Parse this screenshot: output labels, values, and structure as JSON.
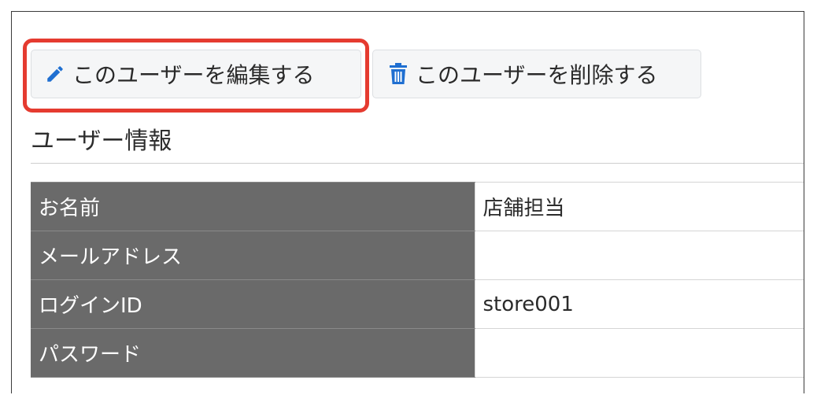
{
  "toolbar": {
    "edit_label": "このユーザーを編集する",
    "edit_icon": "pencil-icon",
    "delete_label": "このユーザーを削除する",
    "delete_icon": "trash-icon"
  },
  "section": {
    "title": "ユーザー情報"
  },
  "user_info": {
    "rows": [
      {
        "label": "お名前",
        "value": "店舗担当"
      },
      {
        "label": "メールアドレス",
        "value": ""
      },
      {
        "label": "ログインID",
        "value": "store001"
      },
      {
        "label": "パスワード",
        "value": ""
      }
    ]
  },
  "colors": {
    "icon_blue": "#1f6fd1",
    "highlight_red": "#e53b30",
    "header_cell_bg": "#6a6a6a"
  }
}
